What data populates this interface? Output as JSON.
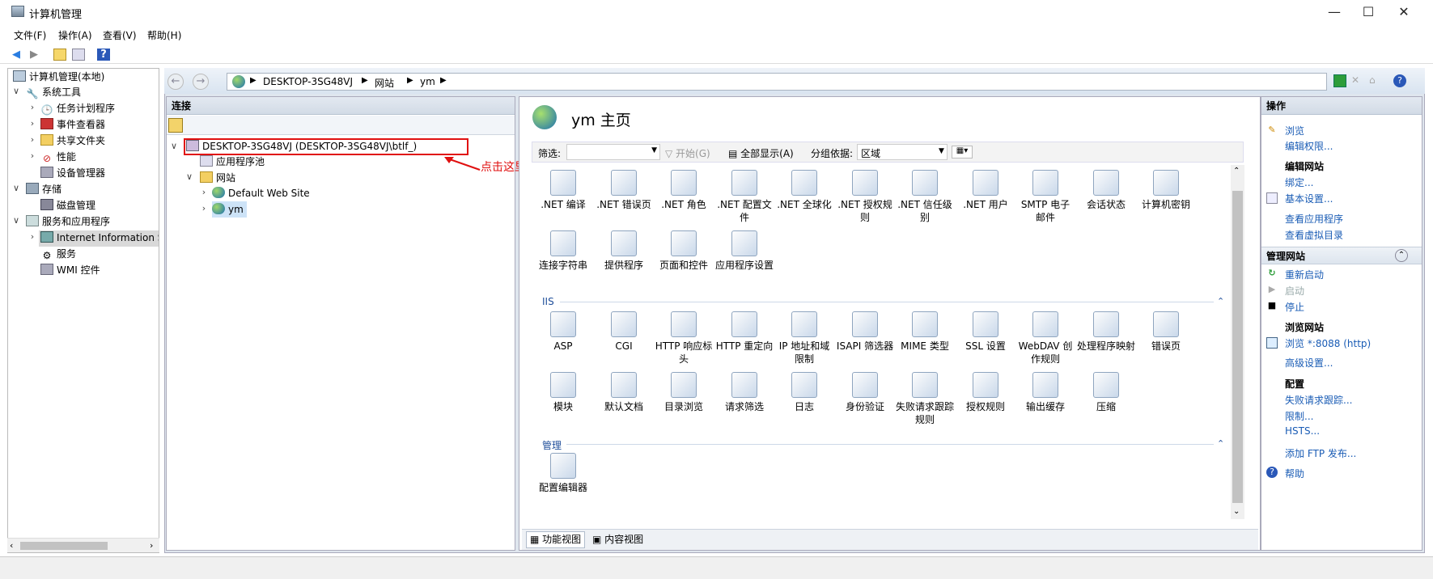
{
  "window": {
    "title": "计算机管理",
    "min": "—",
    "max": "☐",
    "close": "✕"
  },
  "menu": [
    "文件(F)",
    "操作(A)",
    "查看(V)",
    "帮助(H)"
  ],
  "lefttree": {
    "root": "计算机管理(本地)",
    "system_tools": "系统工具",
    "task_scheduler": "任务计划程序",
    "event_viewer": "事件查看器",
    "shared_folders": "共享文件夹",
    "performance": "性能",
    "device_manager": "设备管理器",
    "storage": "存储",
    "disk_management": "磁盘管理",
    "services_apps": "服务和应用程序",
    "iis": "Internet Information S",
    "services": "服务",
    "wmi": "WMI 控件"
  },
  "address": {
    "parts": [
      "DESKTOP-3SG48VJ",
      "网站",
      "ym"
    ]
  },
  "connections": {
    "header": "连接",
    "server": "DESKTOP-3SG48VJ (DESKTOP-3SG48VJ\\btlf_)",
    "app_pools": "应用程序池",
    "sites": "网站",
    "default_site": "Default Web Site",
    "ym": "ym",
    "annotation": "点击这里"
  },
  "center": {
    "title": "ym 主页",
    "filter_label": "筛选:",
    "start": "开始(G)",
    "show_all": "全部显示(A)",
    "group_by": "分组依据:",
    "group_value": "区域",
    "row1": [
      ".NET 编译",
      ".NET 错误页",
      ".NET 角色",
      ".NET 配置文件",
      ".NET 全球化",
      ".NET 授权规则",
      ".NET 信任级别",
      ".NET 用户",
      "SMTP 电子邮件",
      "会话状态",
      "计算机密钥"
    ],
    "row2": [
      "连接字符串",
      "提供程序",
      "页面和控件",
      "应用程序设置"
    ],
    "group_iis": "IIS",
    "row3": [
      "ASP",
      "CGI",
      "HTTP 响应标头",
      "HTTP 重定向",
      "IP 地址和域限制",
      "ISAPI 筛选器",
      "MIME 类型",
      "SSL 设置",
      "WebDAV 创作规则",
      "处理程序映射",
      "错误页"
    ],
    "row4": [
      "模块",
      "默认文档",
      "目录浏览",
      "请求筛选",
      "日志",
      "身份验证",
      "失败请求跟踪规则",
      "授权规则",
      "输出缓存",
      "压缩"
    ],
    "group_manage": "管理",
    "row5": [
      "配置编辑器"
    ],
    "tab_features": "功能视图",
    "tab_content": "内容视图"
  },
  "actions": {
    "header": "操作",
    "browse": "浏览",
    "edit_perms": "编辑权限...",
    "edit_site": "编辑网站",
    "bindings": "绑定...",
    "basic_settings": "基本设置...",
    "view_apps": "查看应用程序",
    "view_vdirs": "查看虚拟目录",
    "manage_site": "管理网站",
    "restart": "重新启动",
    "start": "启动",
    "stop": "停止",
    "browse_site": "浏览网站",
    "browse_port": "浏览 *:8088 (http)",
    "advanced": "高级设置...",
    "config": "配置",
    "failed_trace": "失败请求跟踪...",
    "limits": "限制...",
    "hsts": "HSTS...",
    "add_ftp": "添加 FTP 发布...",
    "help": "帮助"
  }
}
